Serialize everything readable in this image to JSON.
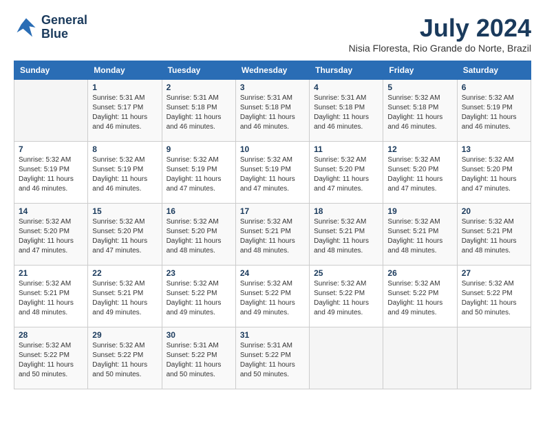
{
  "logo": {
    "line1": "General",
    "line2": "Blue"
  },
  "title": "July 2024",
  "subtitle": "Nisia Floresta, Rio Grande do Norte, Brazil",
  "days_of_week": [
    "Sunday",
    "Monday",
    "Tuesday",
    "Wednesday",
    "Thursday",
    "Friday",
    "Saturday"
  ],
  "weeks": [
    [
      {
        "day": "",
        "detail": ""
      },
      {
        "day": "1",
        "detail": "Sunrise: 5:31 AM\nSunset: 5:17 PM\nDaylight: 11 hours\nand 46 minutes."
      },
      {
        "day": "2",
        "detail": "Sunrise: 5:31 AM\nSunset: 5:18 PM\nDaylight: 11 hours\nand 46 minutes."
      },
      {
        "day": "3",
        "detail": "Sunrise: 5:31 AM\nSunset: 5:18 PM\nDaylight: 11 hours\nand 46 minutes."
      },
      {
        "day": "4",
        "detail": "Sunrise: 5:31 AM\nSunset: 5:18 PM\nDaylight: 11 hours\nand 46 minutes."
      },
      {
        "day": "5",
        "detail": "Sunrise: 5:32 AM\nSunset: 5:18 PM\nDaylight: 11 hours\nand 46 minutes."
      },
      {
        "day": "6",
        "detail": "Sunrise: 5:32 AM\nSunset: 5:19 PM\nDaylight: 11 hours\nand 46 minutes."
      }
    ],
    [
      {
        "day": "7",
        "detail": "Sunrise: 5:32 AM\nSunset: 5:19 PM\nDaylight: 11 hours\nand 46 minutes."
      },
      {
        "day": "8",
        "detail": "Sunrise: 5:32 AM\nSunset: 5:19 PM\nDaylight: 11 hours\nand 46 minutes."
      },
      {
        "day": "9",
        "detail": "Sunrise: 5:32 AM\nSunset: 5:19 PM\nDaylight: 11 hours\nand 47 minutes."
      },
      {
        "day": "10",
        "detail": "Sunrise: 5:32 AM\nSunset: 5:19 PM\nDaylight: 11 hours\nand 47 minutes."
      },
      {
        "day": "11",
        "detail": "Sunrise: 5:32 AM\nSunset: 5:20 PM\nDaylight: 11 hours\nand 47 minutes."
      },
      {
        "day": "12",
        "detail": "Sunrise: 5:32 AM\nSunset: 5:20 PM\nDaylight: 11 hours\nand 47 minutes."
      },
      {
        "day": "13",
        "detail": "Sunrise: 5:32 AM\nSunset: 5:20 PM\nDaylight: 11 hours\nand 47 minutes."
      }
    ],
    [
      {
        "day": "14",
        "detail": "Sunrise: 5:32 AM\nSunset: 5:20 PM\nDaylight: 11 hours\nand 47 minutes."
      },
      {
        "day": "15",
        "detail": "Sunrise: 5:32 AM\nSunset: 5:20 PM\nDaylight: 11 hours\nand 47 minutes."
      },
      {
        "day": "16",
        "detail": "Sunrise: 5:32 AM\nSunset: 5:20 PM\nDaylight: 11 hours\nand 48 minutes."
      },
      {
        "day": "17",
        "detail": "Sunrise: 5:32 AM\nSunset: 5:21 PM\nDaylight: 11 hours\nand 48 minutes."
      },
      {
        "day": "18",
        "detail": "Sunrise: 5:32 AM\nSunset: 5:21 PM\nDaylight: 11 hours\nand 48 minutes."
      },
      {
        "day": "19",
        "detail": "Sunrise: 5:32 AM\nSunset: 5:21 PM\nDaylight: 11 hours\nand 48 minutes."
      },
      {
        "day": "20",
        "detail": "Sunrise: 5:32 AM\nSunset: 5:21 PM\nDaylight: 11 hours\nand 48 minutes."
      }
    ],
    [
      {
        "day": "21",
        "detail": "Sunrise: 5:32 AM\nSunset: 5:21 PM\nDaylight: 11 hours\nand 48 minutes."
      },
      {
        "day": "22",
        "detail": "Sunrise: 5:32 AM\nSunset: 5:21 PM\nDaylight: 11 hours\nand 49 minutes."
      },
      {
        "day": "23",
        "detail": "Sunrise: 5:32 AM\nSunset: 5:22 PM\nDaylight: 11 hours\nand 49 minutes."
      },
      {
        "day": "24",
        "detail": "Sunrise: 5:32 AM\nSunset: 5:22 PM\nDaylight: 11 hours\nand 49 minutes."
      },
      {
        "day": "25",
        "detail": "Sunrise: 5:32 AM\nSunset: 5:22 PM\nDaylight: 11 hours\nand 49 minutes."
      },
      {
        "day": "26",
        "detail": "Sunrise: 5:32 AM\nSunset: 5:22 PM\nDaylight: 11 hours\nand 49 minutes."
      },
      {
        "day": "27",
        "detail": "Sunrise: 5:32 AM\nSunset: 5:22 PM\nDaylight: 11 hours\nand 50 minutes."
      }
    ],
    [
      {
        "day": "28",
        "detail": "Sunrise: 5:32 AM\nSunset: 5:22 PM\nDaylight: 11 hours\nand 50 minutes."
      },
      {
        "day": "29",
        "detail": "Sunrise: 5:32 AM\nSunset: 5:22 PM\nDaylight: 11 hours\nand 50 minutes."
      },
      {
        "day": "30",
        "detail": "Sunrise: 5:31 AM\nSunset: 5:22 PM\nDaylight: 11 hours\nand 50 minutes."
      },
      {
        "day": "31",
        "detail": "Sunrise: 5:31 AM\nSunset: 5:22 PM\nDaylight: 11 hours\nand 50 minutes."
      },
      {
        "day": "",
        "detail": ""
      },
      {
        "day": "",
        "detail": ""
      },
      {
        "day": "",
        "detail": ""
      }
    ]
  ]
}
